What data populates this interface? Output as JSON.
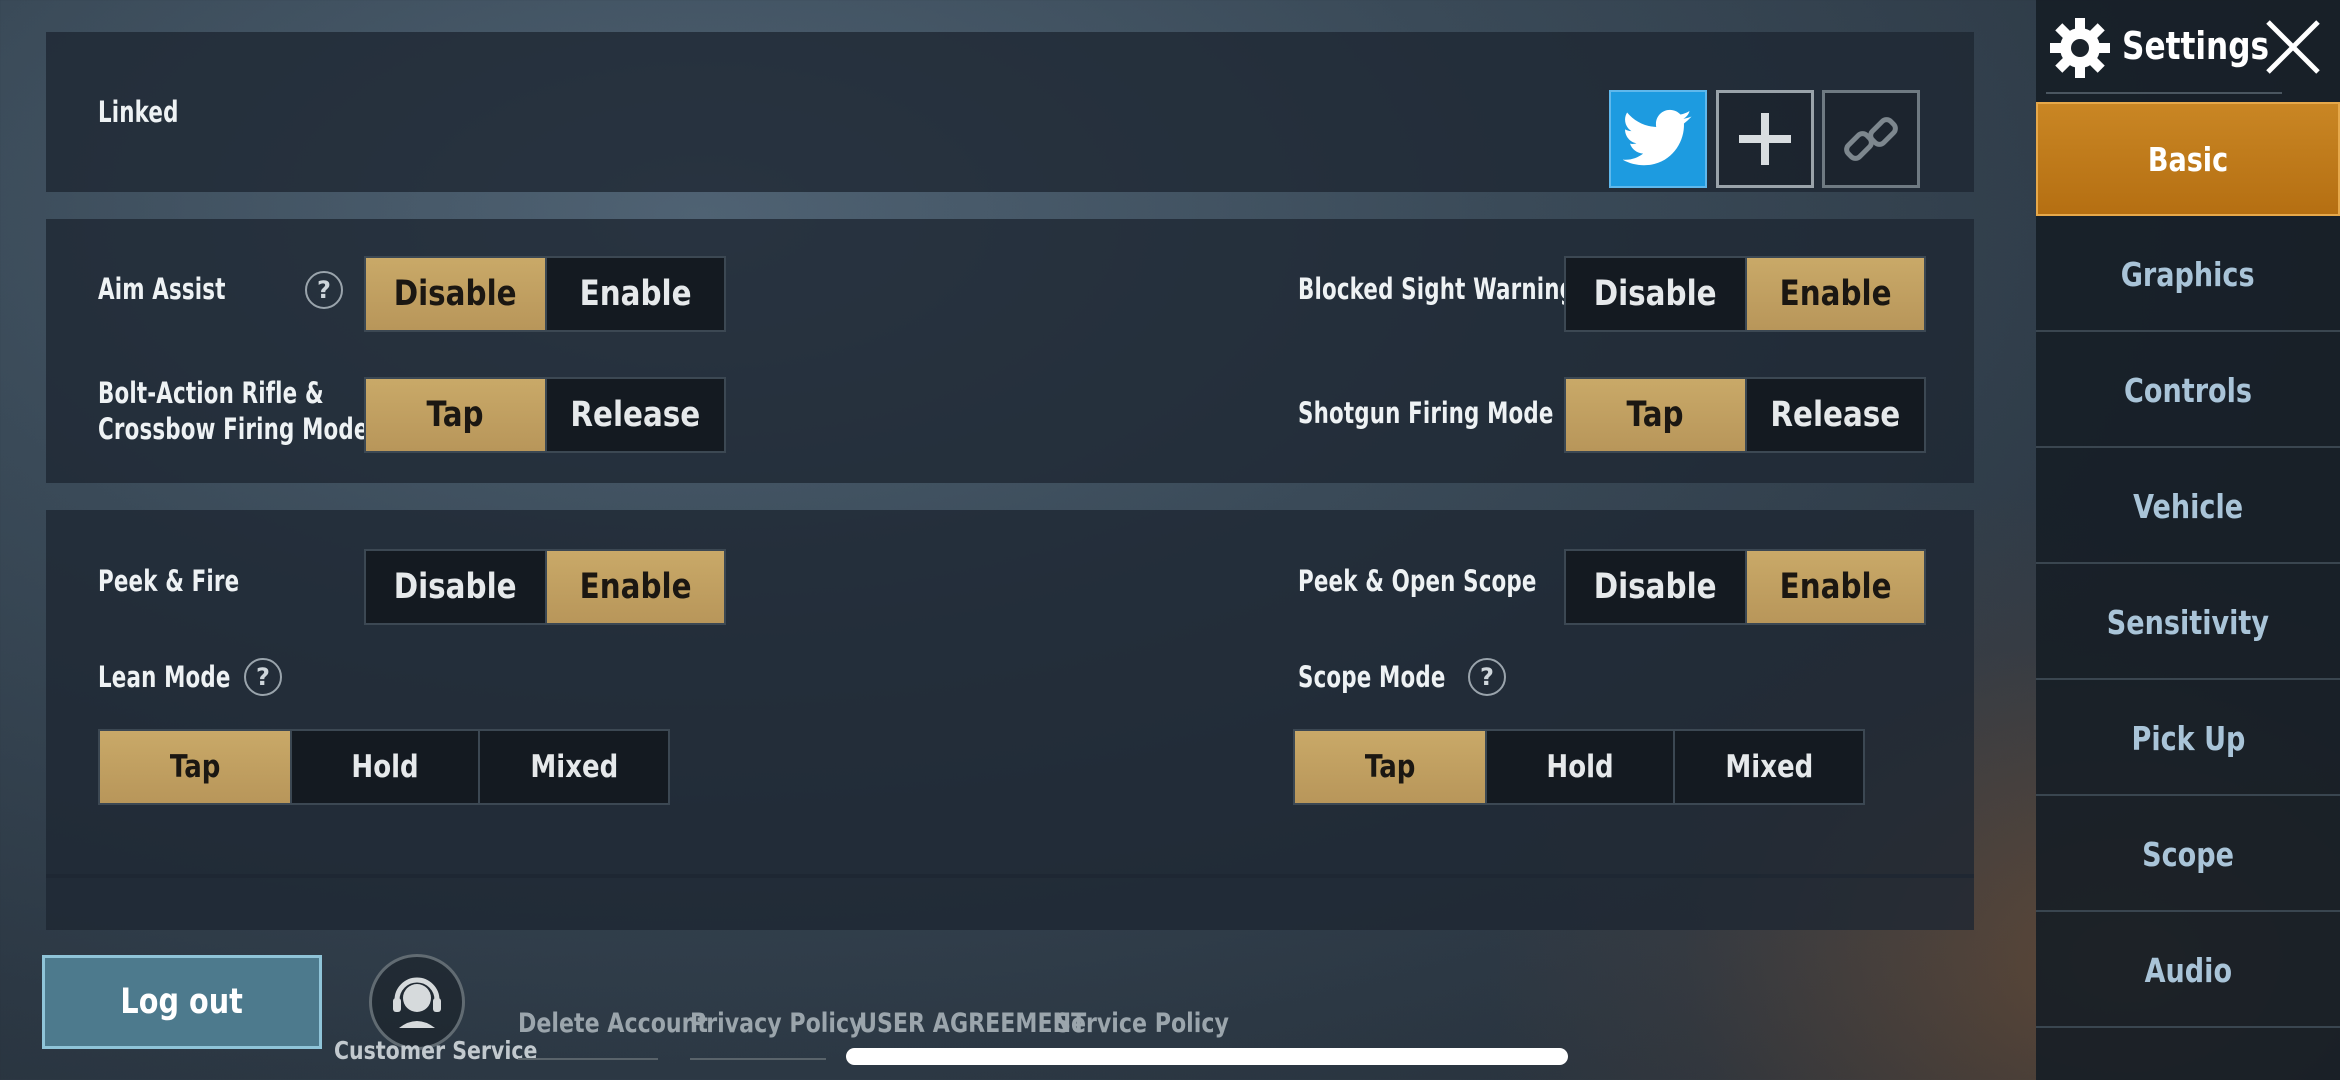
{
  "linked": {
    "label": "Linked",
    "buttons": [
      "twitter-icon",
      "plus-icon",
      "unlink-icon"
    ]
  },
  "settings_group_1": {
    "aim_assist": {
      "label": "Aim Assist",
      "help": "?",
      "options": [
        "Disable",
        "Enable"
      ],
      "selected": "Disable"
    },
    "blocked_sight_warning": {
      "label": "Blocked Sight Warning",
      "options": [
        "Disable",
        "Enable"
      ],
      "selected": "Enable"
    },
    "bolt_action": {
      "label_line1": "Bolt-Action Rifle &",
      "label_line2": "Crossbow Firing Mode",
      "options": [
        "Tap",
        "Release"
      ],
      "selected": "Tap"
    },
    "shotgun_firing_mode": {
      "label": "Shotgun Firing Mode",
      "options": [
        "Tap",
        "Release"
      ],
      "selected": "Tap"
    }
  },
  "settings_group_2": {
    "peek_fire": {
      "label": "Peek & Fire",
      "options": [
        "Disable",
        "Enable"
      ],
      "selected": "Enable"
    },
    "peek_open_scope": {
      "label": "Peek & Open Scope",
      "options": [
        "Disable",
        "Enable"
      ],
      "selected": "Enable"
    },
    "lean_mode": {
      "label": "Lean Mode",
      "help": "?",
      "options": [
        "Tap",
        "Hold",
        "Mixed"
      ],
      "selected": "Tap"
    },
    "scope_mode": {
      "label": "Scope Mode",
      "help": "?",
      "options": [
        "Tap",
        "Hold",
        "Mixed"
      ],
      "selected": "Tap"
    }
  },
  "sidebar": {
    "title": "Settings",
    "items": [
      {
        "label": "Basic",
        "active": true
      },
      {
        "label": "Graphics",
        "active": false
      },
      {
        "label": "Controls",
        "active": false
      },
      {
        "label": "Vehicle",
        "active": false
      },
      {
        "label": "Sensitivity",
        "active": false
      },
      {
        "label": "Pick Up",
        "active": false
      },
      {
        "label": "Scope",
        "active": false
      },
      {
        "label": "Audio",
        "active": false
      }
    ]
  },
  "footer": {
    "logout": "Log out",
    "customer_service": "Customer Service",
    "delete_account": "Delete Account",
    "privacy_policy": "Privacy Policy",
    "user_agreement": "USER AGREEMENT",
    "service_policy": "Service Policy"
  },
  "colors": {
    "selected_option": "#c9a968",
    "active_tab": "#c98624",
    "twitter": "#1d9be0",
    "logout": "#4d7a8d"
  }
}
